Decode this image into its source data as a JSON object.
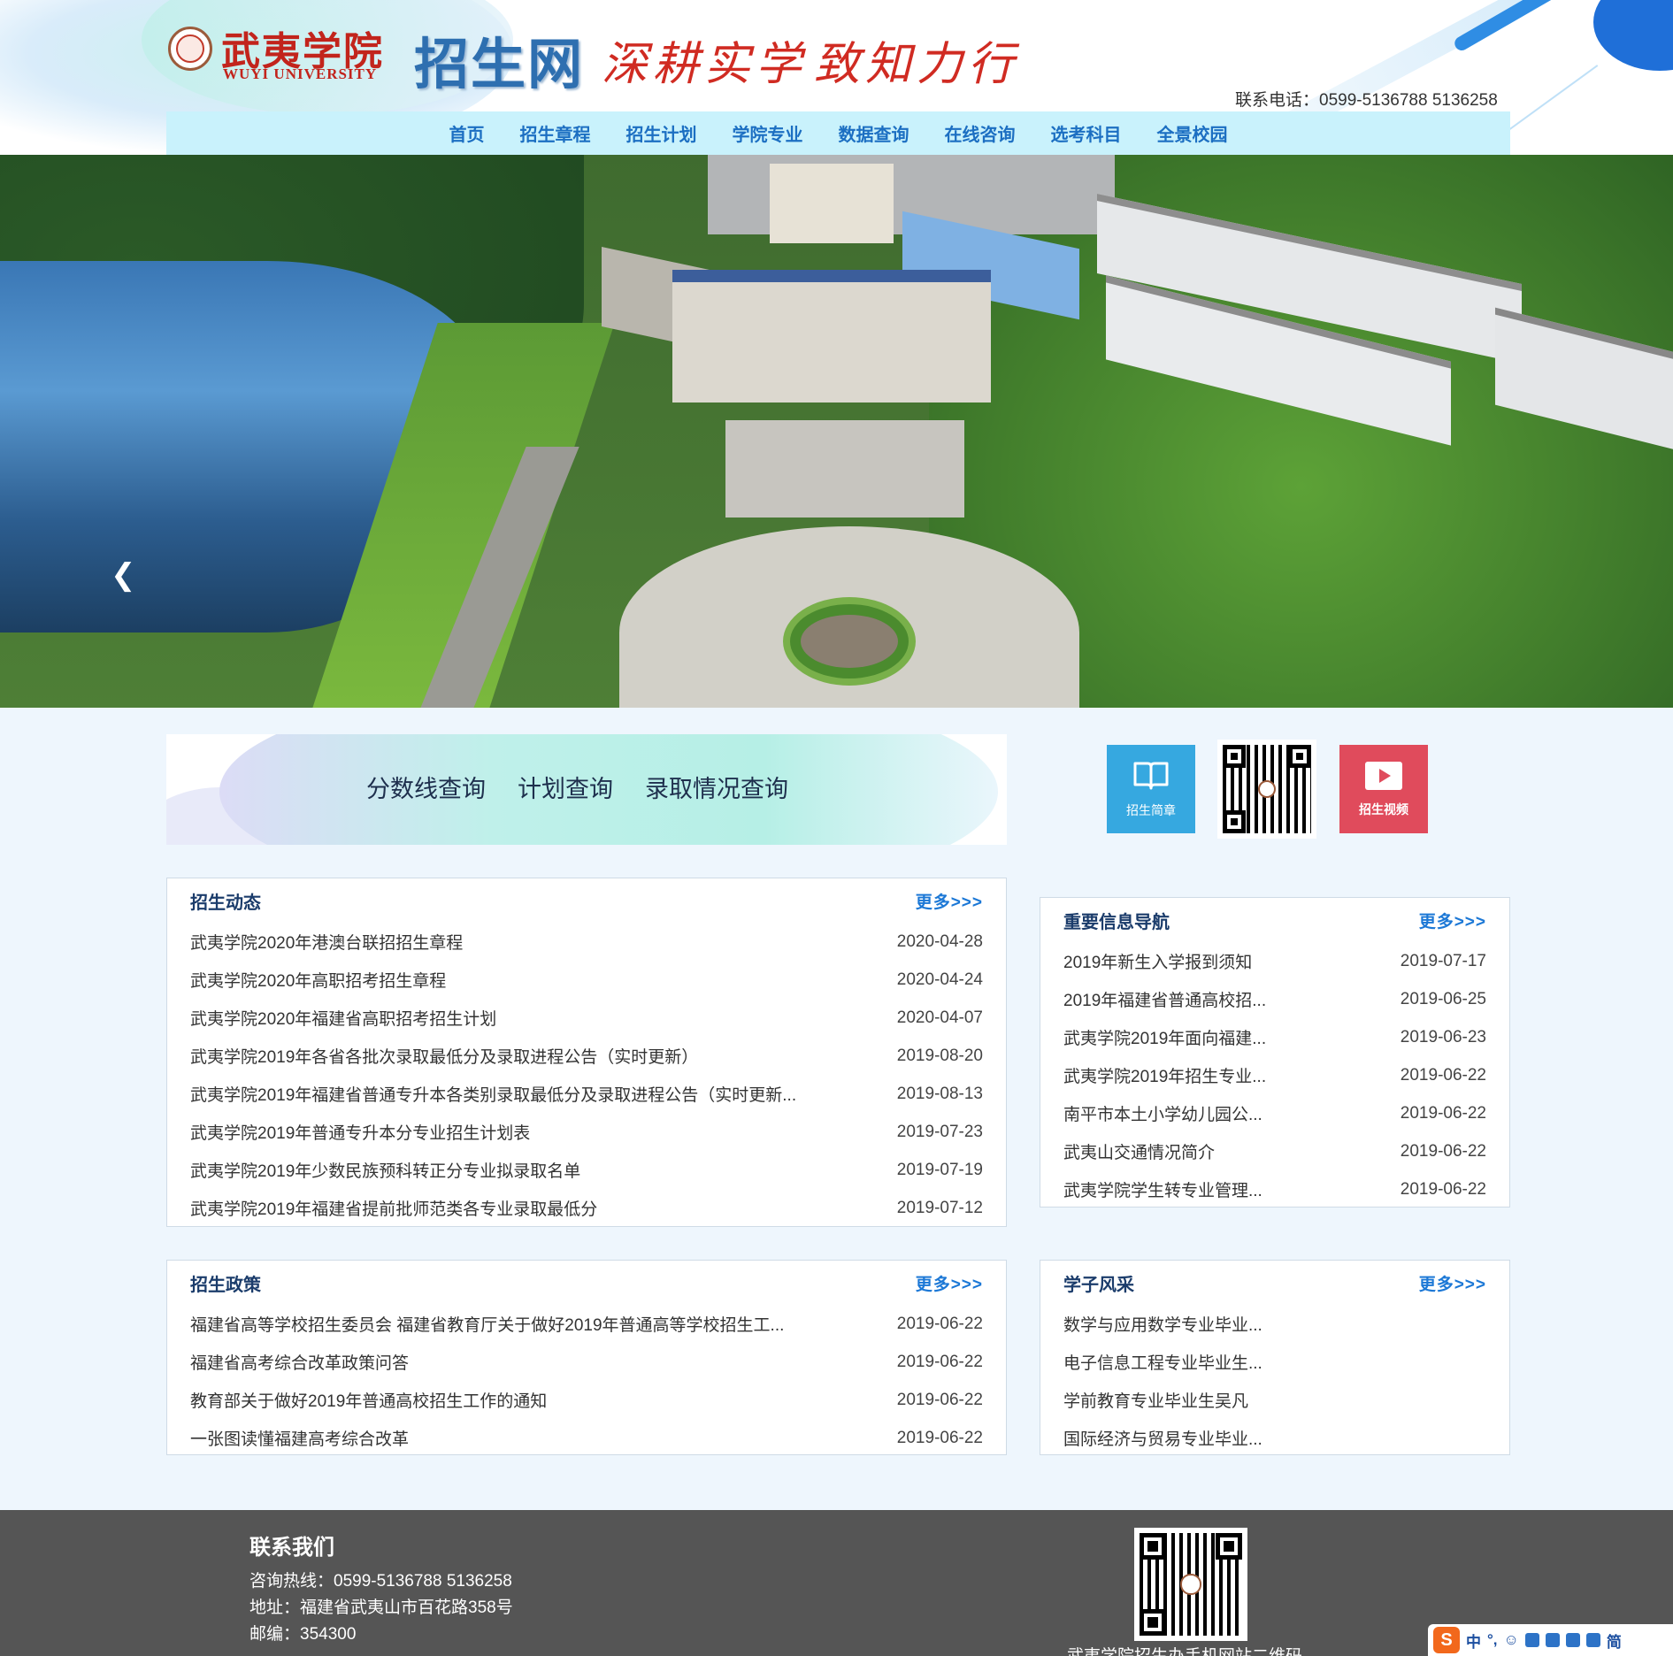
{
  "header": {
    "logo_cn": "武夷学院",
    "logo_en": "WUYI UNIVERSITY",
    "site_name": "招生网",
    "motto_1": "深耕实学",
    "motto_2": "致知力行",
    "phone": "联系电话：0599-5136788 5136258"
  },
  "nav": {
    "items": [
      {
        "label": "首页"
      },
      {
        "label": "招生章程"
      },
      {
        "label": "招生计划"
      },
      {
        "label": "学院专业"
      },
      {
        "label": "数据查询"
      },
      {
        "label": "在线咨询"
      },
      {
        "label": "选考科目"
      },
      {
        "label": "全景校园"
      }
    ]
  },
  "banner": {
    "prev_icon": "chevron-left-icon",
    "slide_count": 5,
    "active_slide": 2
  },
  "query": {
    "links": [
      {
        "label": "分数线查询"
      },
      {
        "label": "计划查询"
      },
      {
        "label": "录取情况查询"
      }
    ]
  },
  "quick": {
    "brochure_label": "招生简章",
    "brochure_icon": "open-book-icon",
    "video_label": "招生视频",
    "video_icon": "play-icon"
  },
  "panels": {
    "news": {
      "title": "招生动态",
      "more": "更多>>>",
      "items": [
        {
          "title": "武夷学院2020年港澳台联招招生章程",
          "date": "2020-04-28"
        },
        {
          "title": "武夷学院2020年高职招考招生章程",
          "date": "2020-04-24"
        },
        {
          "title": "武夷学院2020年福建省高职招考招生计划",
          "date": "2020-04-07"
        },
        {
          "title": "武夷学院2019年各省各批次录取最低分及录取进程公告（实时更新）",
          "date": "2019-08-20"
        },
        {
          "title": "武夷学院2019年福建省普通专升本各类别录取最低分及录取进程公告（实时更新...",
          "date": "2019-08-13"
        },
        {
          "title": "武夷学院2019年普通专升本分专业招生计划表",
          "date": "2019-07-23"
        },
        {
          "title": "武夷学院2019年少数民族预科转正分专业拟录取名单",
          "date": "2019-07-19"
        },
        {
          "title": "武夷学院2019年福建省提前批师范类各专业录取最低分",
          "date": "2019-07-12"
        }
      ]
    },
    "important": {
      "title": "重要信息导航",
      "more": "更多>>>",
      "items": [
        {
          "title": "2019年新生入学报到须知",
          "date": "2019-07-17"
        },
        {
          "title": "2019年福建省普通高校招...",
          "date": "2019-06-25"
        },
        {
          "title": "武夷学院2019年面向福建...",
          "date": "2019-06-23"
        },
        {
          "title": "武夷学院2019年招生专业...",
          "date": "2019-06-22"
        },
        {
          "title": "南平市本土小学幼儿园公...",
          "date": "2019-06-22"
        },
        {
          "title": "武夷山交通情况简介",
          "date": "2019-06-22"
        },
        {
          "title": "武夷学院学生转专业管理...",
          "date": "2019-06-22"
        }
      ]
    },
    "policy": {
      "title": "招生政策",
      "more": "更多>>>",
      "items": [
        {
          "title": "福建省高等学校招生委员会 福建省教育厅关于做好2019年普通高等学校招生工...",
          "date": "2019-06-22"
        },
        {
          "title": "福建省高考综合改革政策问答",
          "date": "2019-06-22"
        },
        {
          "title": "教育部关于做好2019年普通高校招生工作的通知",
          "date": "2019-06-22"
        },
        {
          "title": "一张图读懂福建高考综合改革",
          "date": "2019-06-22"
        }
      ]
    },
    "students": {
      "title": "学子风采",
      "more": "更多>>>",
      "items": [
        {
          "title": "数学与应用数学专业毕业..."
        },
        {
          "title": "电子信息工程专业毕业生..."
        },
        {
          "title": "学前教育专业毕业生吴凡"
        },
        {
          "title": "国际经济与贸易专业毕业..."
        }
      ]
    }
  },
  "footer": {
    "title": "联系我们",
    "hotline": "咨询热线：0599-5136788 5136258",
    "address": "地址：福建省武夷山市百花路358号",
    "zip": "邮编：354300",
    "qr_caption": "武夷学院招生办手机网站二维码"
  },
  "ime": {
    "logo": "S",
    "items": [
      "中",
      "°,",
      "☺",
      "简"
    ]
  },
  "colors": {
    "nav_bg": "#c9f2fc",
    "nav_text": "#1c6fc2",
    "panel_title": "#1b3c6b",
    "more_link": "#1c78d6",
    "brochure_bg": "#36a8e0",
    "video_bg": "#e04b5c",
    "footer_bg": "#555555",
    "logo_red": "#c2241c"
  }
}
